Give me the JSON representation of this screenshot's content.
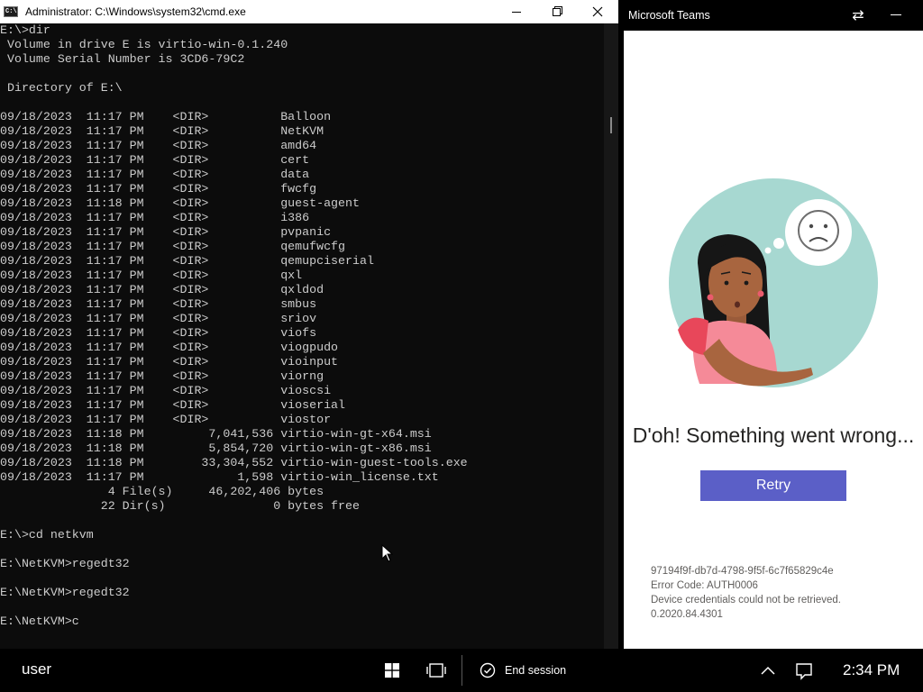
{
  "cmd": {
    "title": "Administrator: C:\\Windows\\system32\\cmd.exe",
    "icon": "cmd-icon",
    "icon_text": "C:\\",
    "lines": [
      "E:\\>dir",
      " Volume in drive E is virtio-win-0.1.240",
      " Volume Serial Number is 3CD6-79C2",
      "",
      " Directory of E:\\",
      "",
      "09/18/2023  11:17 PM    <DIR>          Balloon",
      "09/18/2023  11:17 PM    <DIR>          NetKVM",
      "09/18/2023  11:17 PM    <DIR>          amd64",
      "09/18/2023  11:17 PM    <DIR>          cert",
      "09/18/2023  11:17 PM    <DIR>          data",
      "09/18/2023  11:17 PM    <DIR>          fwcfg",
      "09/18/2023  11:18 PM    <DIR>          guest-agent",
      "09/18/2023  11:17 PM    <DIR>          i386",
      "09/18/2023  11:17 PM    <DIR>          pvpanic",
      "09/18/2023  11:17 PM    <DIR>          qemufwcfg",
      "09/18/2023  11:17 PM    <DIR>          qemupciserial",
      "09/18/2023  11:17 PM    <DIR>          qxl",
      "09/18/2023  11:17 PM    <DIR>          qxldod",
      "09/18/2023  11:17 PM    <DIR>          smbus",
      "09/18/2023  11:17 PM    <DIR>          sriov",
      "09/18/2023  11:17 PM    <DIR>          viofs",
      "09/18/2023  11:17 PM    <DIR>          viogpudo",
      "09/18/2023  11:17 PM    <DIR>          vioinput",
      "09/18/2023  11:17 PM    <DIR>          viorng",
      "09/18/2023  11:17 PM    <DIR>          vioscsi",
      "09/18/2023  11:17 PM    <DIR>          vioserial",
      "09/18/2023  11:17 PM    <DIR>          viostor",
      "09/18/2023  11:18 PM         7,041,536 virtio-win-gt-x64.msi",
      "09/18/2023  11:18 PM         5,854,720 virtio-win-gt-x86.msi",
      "09/18/2023  11:18 PM        33,304,552 virtio-win-guest-tools.exe",
      "09/18/2023  11:17 PM             1,598 virtio-win_license.txt",
      "               4 File(s)     46,202,406 bytes",
      "              22 Dir(s)               0 bytes free",
      "",
      "E:\\>cd netkvm",
      "",
      "E:\\NetKVM>regedt32",
      "",
      "E:\\NetKVM>regedt32",
      "",
      "E:\\NetKVM>c"
    ]
  },
  "teams": {
    "title": "Microsoft Teams",
    "swap_icon": "swap-arrows-icon",
    "error_title": "D'oh! Something went wrong...",
    "retry_label": "Retry",
    "details": [
      "97194f9f-db7d-4798-9f5f-6c7f65829c4e",
      "Error Code: AUTH0006",
      "Device credentials could not be retrieved.",
      "0.2020.84.4301"
    ],
    "colors": {
      "accent": "#5b5fc7",
      "circle": "#a7d8d1"
    }
  },
  "taskbar": {
    "user": "user",
    "end_session_label": "End session",
    "clock": "2:34 PM"
  }
}
